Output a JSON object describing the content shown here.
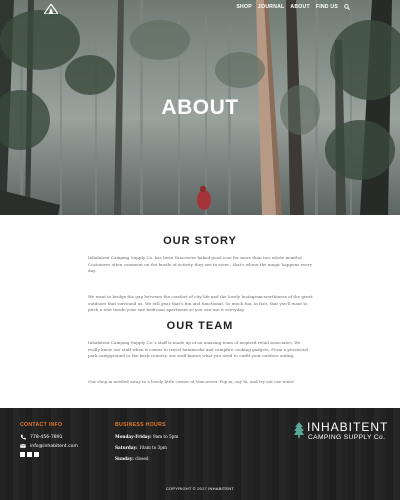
{
  "nav": {
    "items": [
      {
        "label": "SHOP"
      },
      {
        "label": "JOURNAL"
      },
      {
        "label": "ABOUT"
      },
      {
        "label": "FIND US"
      }
    ]
  },
  "hero": {
    "title": "ABOUT"
  },
  "story": {
    "heading": "OUR STORY",
    "p1": "Inhabitent Camping Supply Co. has been Vancouver baked-good icon for more than two whole months! Customers often comment on the bustle of activity they see in store.. that's where the magic happens every day.",
    "p2": "We want to bridge the gap between the comfort of city life and the lovely Instagram-worthiness of the great outdoors that surround us. We sell gear that's fun and functional. So much fun, in fact, that you'll want to pitch a tent inside your one-bedroom apartment so you can use it everyday."
  },
  "team": {
    "heading": "OUR TEAM",
    "p1": "Inhabitent Camping Supply Co.'s staff is made up of an amazing team of inspired retail associates. We really know our stuff when it comes to travel hammocks and campfire cooking gadgets. From a provincial park campground to the back-country, our staff knows what you need to outfit your outdoor outing.",
    "p2": "Our shop in nestled away in a lovely little corner of Vancouver. Pop in, say hi, and try out our tents!"
  },
  "footer": {
    "contact_heading": "CONTACT INFO",
    "phone": "778-456-7891",
    "email": "info@inhabitent.com",
    "hours_heading": "BUSINESS HOURS",
    "weekday_label": "Monday-Friday:",
    "weekday_hours": "9am to 5pm",
    "saturday_label": "Saturday:",
    "saturday_hours": "10am to 3pm",
    "sunday_label": "Sunday:",
    "sunday_hours": "closed",
    "brand_name": "INHABITENT",
    "brand_sub": "CAMPING SUPPLY Co.",
    "copyright": "COPYRIGHT © 2017 INHABITENT"
  },
  "colors": {
    "accent": "#e07a2c",
    "brand_tree": "#5aa79a",
    "footer_bg": "#232323",
    "heading": "#1f1f1f",
    "body_text": "#6a6a6a"
  },
  "icons": {
    "logo": "tent-logo-icon",
    "search": "search-icon",
    "phone": "phone-icon",
    "email": "envelope-icon",
    "social": [
      "facebook-icon",
      "twitter-icon",
      "instagram-icon"
    ],
    "brand": "pine-tree-icon"
  }
}
